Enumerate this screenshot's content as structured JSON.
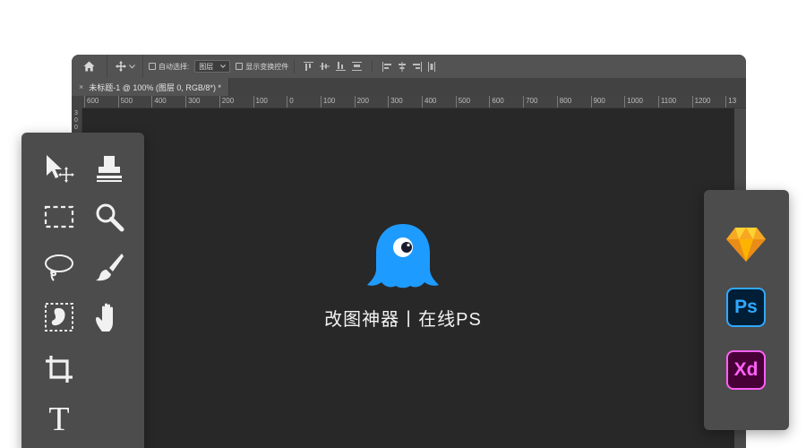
{
  "options_bar": {
    "auto_select_label": "自动选择:",
    "auto_select_target": "图层",
    "show_transform_label": "显示变换控件"
  },
  "document_tab": {
    "close": "×",
    "title": "未标题-1 @ 100% (图层 0, RGB/8*) *"
  },
  "ruler": {
    "top_ticks": [
      "600",
      "500",
      "400",
      "300",
      "200",
      "100",
      "0",
      "100",
      "200",
      "300",
      "400",
      "500",
      "600",
      "700",
      "800",
      "900",
      "1000",
      "1100",
      "1200",
      "13"
    ],
    "left_ticks": [
      "3",
      "0",
      "0"
    ]
  },
  "brand": {
    "logo_icon": "ghost-mascot-icon",
    "name": "改图神器丨在线PS"
  },
  "tools": [
    {
      "name": "move-tool",
      "icon": "move-arrow-icon"
    },
    {
      "name": "stamp-tool",
      "icon": "clone-stamp-icon"
    },
    {
      "name": "marquee-tool",
      "icon": "rect-marquee-icon"
    },
    {
      "name": "zoom-tool",
      "icon": "magnifier-icon"
    },
    {
      "name": "lasso-tool",
      "icon": "lasso-icon"
    },
    {
      "name": "brush-tool",
      "icon": "brush-icon"
    },
    {
      "name": "quick-select-tool",
      "icon": "quick-select-icon"
    },
    {
      "name": "hand-tool",
      "icon": "hand-icon"
    },
    {
      "name": "crop-tool",
      "icon": "crop-icon"
    },
    {
      "name": "type-tool",
      "icon": "type-icon"
    }
  ],
  "type_tool_glyph": "T",
  "apps": {
    "sketch_icon": "sketch-diamond-icon",
    "ps_label": "Ps",
    "xd_label": "Xd"
  },
  "colors": {
    "brand_blue": "#1E9BFF",
    "sketch_orange": "#F7A823",
    "ps_blue": "#31A8FF",
    "ps_bg": "#001E36",
    "xd_pink": "#FF61F6",
    "xd_bg": "#470137"
  }
}
